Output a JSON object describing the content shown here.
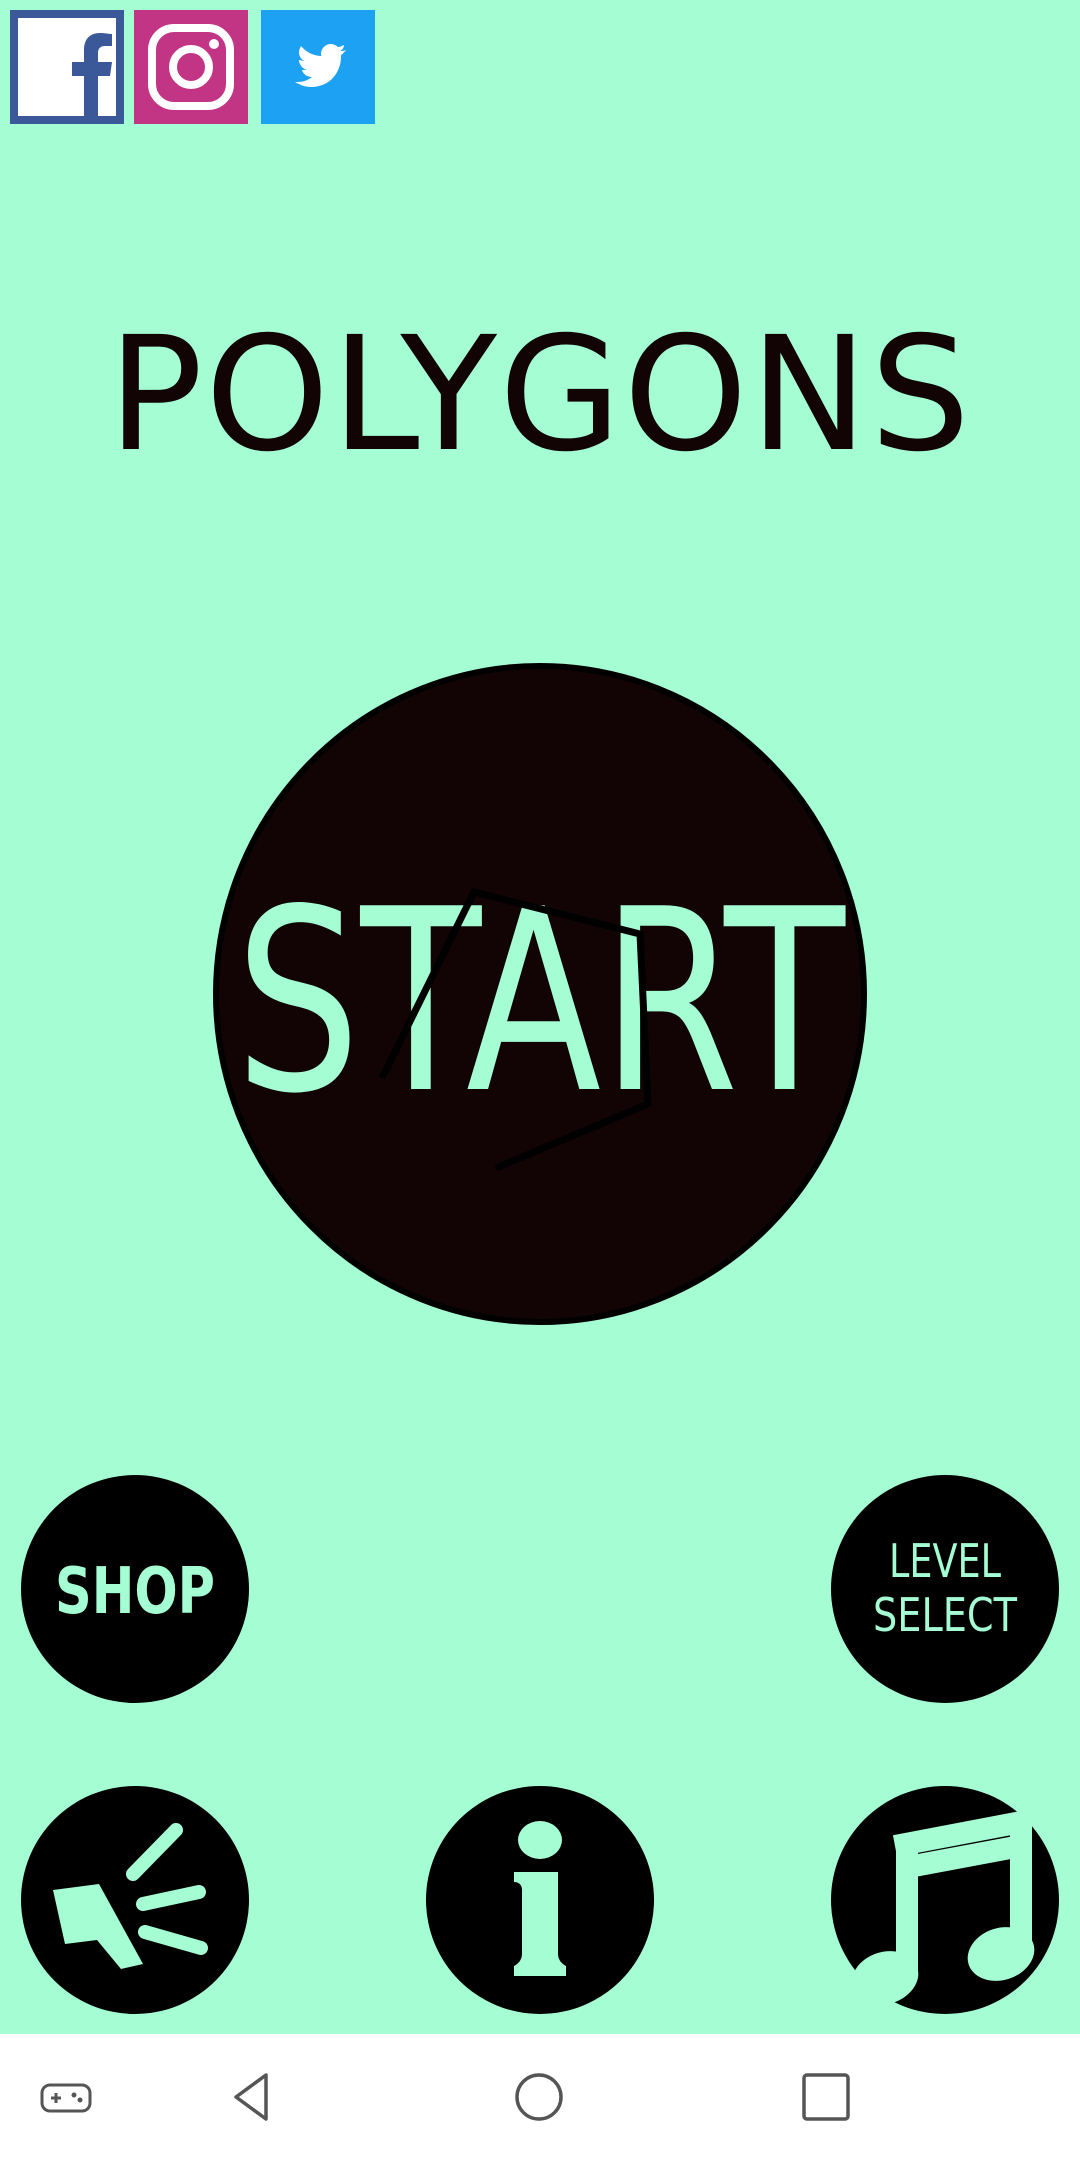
{
  "social": {
    "facebook_icon": "facebook-logo",
    "instagram_icon": "instagram-logo",
    "twitter_icon": "twitter-bird"
  },
  "app": {
    "title": "POLYGONS"
  },
  "start_button": {
    "label": "START"
  },
  "menu": {
    "shop_label": "SHOP",
    "level_select_line1": "LEVEL",
    "level_select_line2": "SELECT",
    "sound_icon": "speaker-icon",
    "info_icon": "info-icon",
    "music_icon": "music-note-icon"
  },
  "system_nav": {
    "game_icon": "gamepad-icon",
    "back_icon": "triangle-back",
    "home_icon": "circle-home",
    "recent_icon": "square-recents"
  },
  "colors": {
    "background": "#a5fdd4",
    "button_fill": "#120404",
    "accent": "#a5fdd4",
    "facebook": "#3b5998",
    "instagram": "#c13584",
    "twitter": "#1da1f2",
    "navbar": "#ffffff"
  }
}
